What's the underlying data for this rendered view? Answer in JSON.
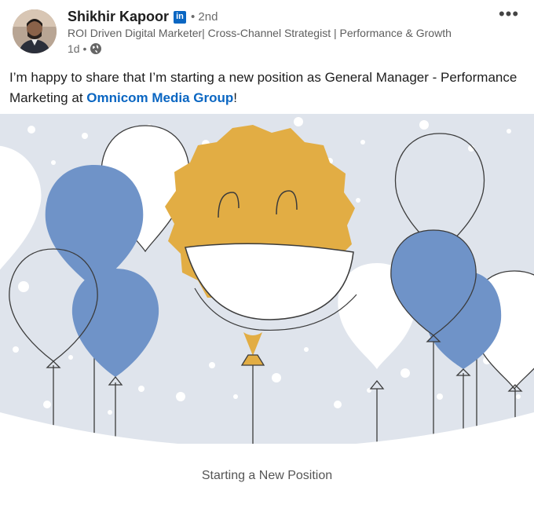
{
  "author": {
    "name": "Shikhir Kapoor",
    "badge": "in",
    "degree": "• 2nd",
    "headline": "ROI Driven Digital Marketer| Cross-Channel Strategist | Performance & Growth",
    "time": "1d •",
    "visibility_icon": "globe-icon"
  },
  "more_icon": "more-options-icon",
  "post": {
    "text_before": "I’m happy to share that I’m starting a new position as General Manager - Performance Marketing at ",
    "company": "Omnicom Media Group",
    "text_after": "!"
  },
  "media": {
    "caption": "Starting a New Position",
    "colors": {
      "background": "#dfe4ec",
      "balloon_blue": "#6f93c8",
      "balloon_white": "#ffffff",
      "sun": "#e2ad44",
      "outline": "#3b3b3b",
      "link": "#0a66c2"
    }
  }
}
